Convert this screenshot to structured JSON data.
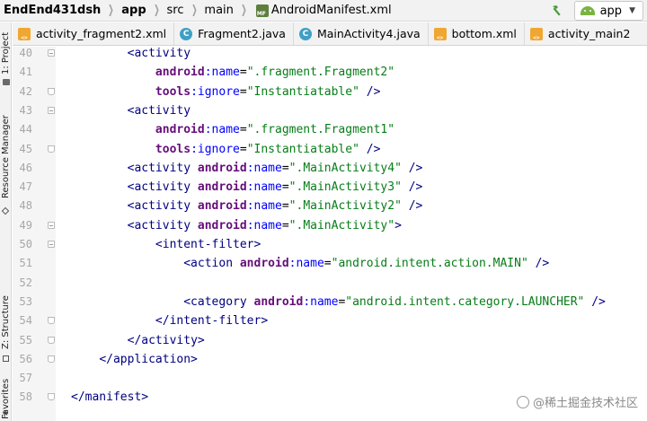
{
  "breadcrumb": {
    "project": "EndEnd431dsh",
    "module": "app",
    "folder1": "src",
    "folder2": "main",
    "file": "AndroidManifest.xml"
  },
  "run_config": {
    "label": "app"
  },
  "left_tools": {
    "project": "1: Project",
    "resource_manager": "Resource Manager",
    "structure": "Z: Structure",
    "favorites": "Favorites"
  },
  "tabs": [
    {
      "label": "activity_fragment2.xml",
      "icon": "xml-file-icon"
    },
    {
      "label": "Fragment2.java",
      "icon": "java-class-icon"
    },
    {
      "label": "MainActivity4.java",
      "icon": "java-class-icon"
    },
    {
      "label": "bottom.xml",
      "icon": "xml-file-icon"
    },
    {
      "label": "activity_main2",
      "icon": "xml-file-icon"
    }
  ],
  "code": [
    {
      "n": "40",
      "indent": "        ",
      "tokens": [
        [
          "tag",
          "<activity"
        ]
      ]
    },
    {
      "n": "41",
      "indent": "            ",
      "tokens": [
        [
          "ns",
          "android"
        ],
        [
          "attr",
          ":name"
        ],
        [
          "plain",
          "="
        ],
        [
          "val",
          "\".fragment.Fragment2\""
        ]
      ]
    },
    {
      "n": "42",
      "indent": "            ",
      "tokens": [
        [
          "ns",
          "tools"
        ],
        [
          "attr",
          ":ignore"
        ],
        [
          "plain",
          "="
        ],
        [
          "val",
          "\"Instantiatable\""
        ],
        [
          "tag",
          " />"
        ]
      ]
    },
    {
      "n": "43",
      "indent": "        ",
      "tokens": [
        [
          "tag",
          "<activity"
        ]
      ]
    },
    {
      "n": "44",
      "indent": "            ",
      "tokens": [
        [
          "ns",
          "android"
        ],
        [
          "attr",
          ":name"
        ],
        [
          "plain",
          "="
        ],
        [
          "val",
          "\".fragment.Fragment1\""
        ]
      ]
    },
    {
      "n": "45",
      "indent": "            ",
      "tokens": [
        [
          "ns",
          "tools"
        ],
        [
          "attr",
          ":ignore"
        ],
        [
          "plain",
          "="
        ],
        [
          "val",
          "\"Instantiatable\""
        ],
        [
          "tag",
          " />"
        ]
      ]
    },
    {
      "n": "46",
      "indent": "        ",
      "tokens": [
        [
          "tag",
          "<activity "
        ],
        [
          "ns",
          "android"
        ],
        [
          "attr",
          ":name"
        ],
        [
          "plain",
          "="
        ],
        [
          "val",
          "\".MainActivity4\""
        ],
        [
          "tag",
          " />"
        ]
      ]
    },
    {
      "n": "47",
      "indent": "        ",
      "tokens": [
        [
          "tag",
          "<activity "
        ],
        [
          "ns",
          "android"
        ],
        [
          "attr",
          ":name"
        ],
        [
          "plain",
          "="
        ],
        [
          "val",
          "\".MainActivity3\""
        ],
        [
          "tag",
          " />"
        ]
      ]
    },
    {
      "n": "48",
      "indent": "        ",
      "tokens": [
        [
          "tag",
          "<activity "
        ],
        [
          "ns",
          "android"
        ],
        [
          "attr",
          ":name"
        ],
        [
          "plain",
          "="
        ],
        [
          "val",
          "\".MainActivity2\""
        ],
        [
          "tag",
          " />"
        ]
      ]
    },
    {
      "n": "49",
      "indent": "        ",
      "tokens": [
        [
          "tag",
          "<activity "
        ],
        [
          "ns",
          "android"
        ],
        [
          "attr",
          ":name"
        ],
        [
          "plain",
          "="
        ],
        [
          "val",
          "\".MainActivity\""
        ],
        [
          "tag",
          ">"
        ]
      ]
    },
    {
      "n": "50",
      "indent": "            ",
      "tokens": [
        [
          "tag",
          "<intent-filter>"
        ]
      ]
    },
    {
      "n": "51",
      "indent": "                ",
      "tokens": [
        [
          "tag",
          "<action "
        ],
        [
          "ns",
          "android"
        ],
        [
          "attr",
          ":name"
        ],
        [
          "plain",
          "="
        ],
        [
          "val",
          "\"android.intent.action.MAIN\""
        ],
        [
          "tag",
          " />"
        ]
      ]
    },
    {
      "n": "52",
      "indent": "",
      "tokens": []
    },
    {
      "n": "53",
      "indent": "                ",
      "tokens": [
        [
          "tag",
          "<category "
        ],
        [
          "ns",
          "android"
        ],
        [
          "attr",
          ":name"
        ],
        [
          "plain",
          "="
        ],
        [
          "val",
          "\"android.intent.category.LAUNCHER\""
        ],
        [
          "tag",
          " />"
        ]
      ]
    },
    {
      "n": "54",
      "indent": "            ",
      "tokens": [
        [
          "tag",
          "</intent-filter>"
        ]
      ]
    },
    {
      "n": "55",
      "indent": "        ",
      "tokens": [
        [
          "tag",
          "</activity>"
        ]
      ]
    },
    {
      "n": "56",
      "indent": "    ",
      "tokens": [
        [
          "tag",
          "</application>"
        ]
      ]
    },
    {
      "n": "57",
      "indent": "",
      "tokens": []
    },
    {
      "n": "58",
      "indent": "",
      "tokens": [
        [
          "tag",
          "</manifest>"
        ]
      ]
    }
  ],
  "watermark": "@稀土掘金技术社区"
}
